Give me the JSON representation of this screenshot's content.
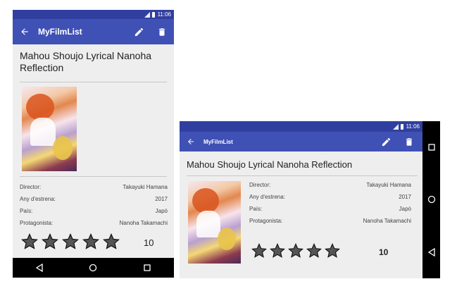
{
  "status_bar": {
    "time": "11:06"
  },
  "toolbar": {
    "app_title": "MyFilmList"
  },
  "movie": {
    "title": "Mahou Shoujo Lyrical Nanoha Reflection",
    "poster_description": "poster",
    "details": [
      {
        "label": "Director:",
        "value": "Takayuki Hamana"
      },
      {
        "label": "Any d'estrena:",
        "value": "2017"
      },
      {
        "label": "País:",
        "value": "Japó"
      },
      {
        "label": "Protagonista:",
        "value": "Nanoha Takamachi"
      }
    ],
    "stars_total": 5,
    "rating": "10"
  },
  "icons": {
    "back": "arrow-back-icon",
    "edit": "pencil-icon",
    "delete": "trash-icon",
    "nav_back": "triangle-back-icon",
    "nav_home": "circle-home-icon",
    "nav_recents": "square-recents-icon"
  },
  "colors": {
    "status_bar": "#303f9f",
    "toolbar": "#3f51b5",
    "background": "#eeeeee",
    "star_fill": "#555555"
  }
}
